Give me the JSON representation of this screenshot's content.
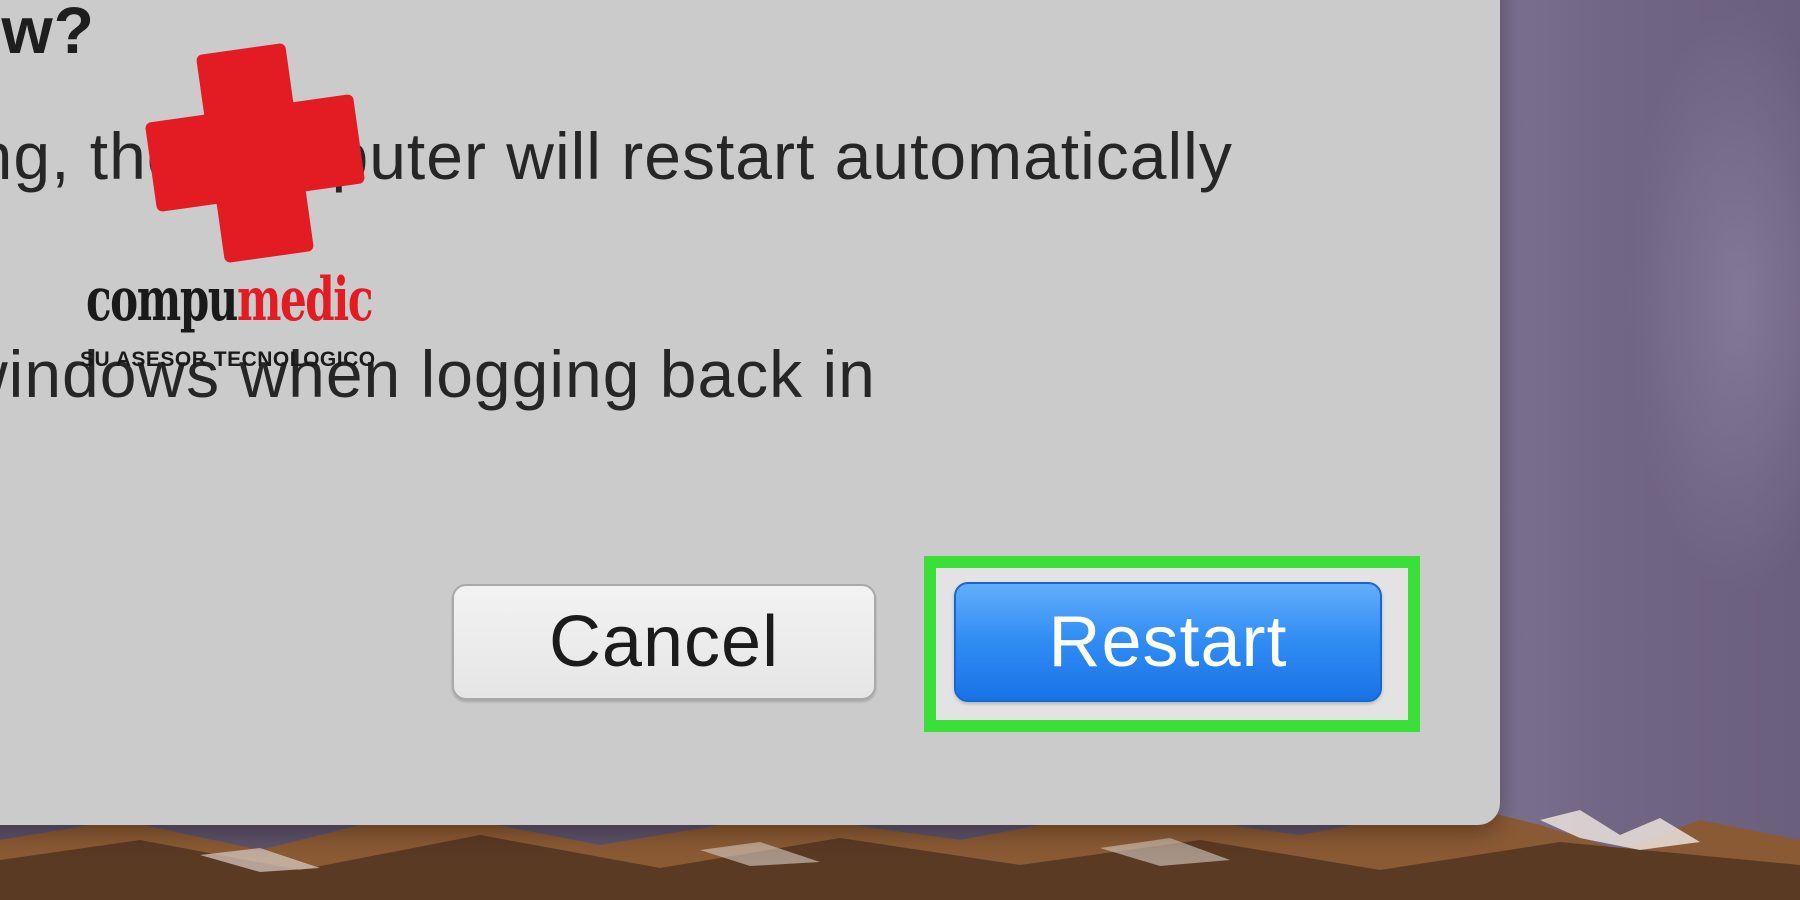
{
  "dialog": {
    "title_fragment": "ow?",
    "body_line1": "ing, the computer will restart automatically",
    "body_line2": "·",
    "checkbox_label": "windows when logging back in",
    "checkbox_checked": false
  },
  "buttons": {
    "cancel_label": "Cancel",
    "restart_label": "Restart"
  },
  "watermark": {
    "brand_part1": "compu",
    "brand_part2": "medic",
    "tagline": "SU ASESOR TECNOLOGICO"
  },
  "colors": {
    "highlight": "#3adf37",
    "primary_button": "#2f8cf4",
    "dialog_bg": "#cbcbcb",
    "logo_red": "#e31b23"
  }
}
